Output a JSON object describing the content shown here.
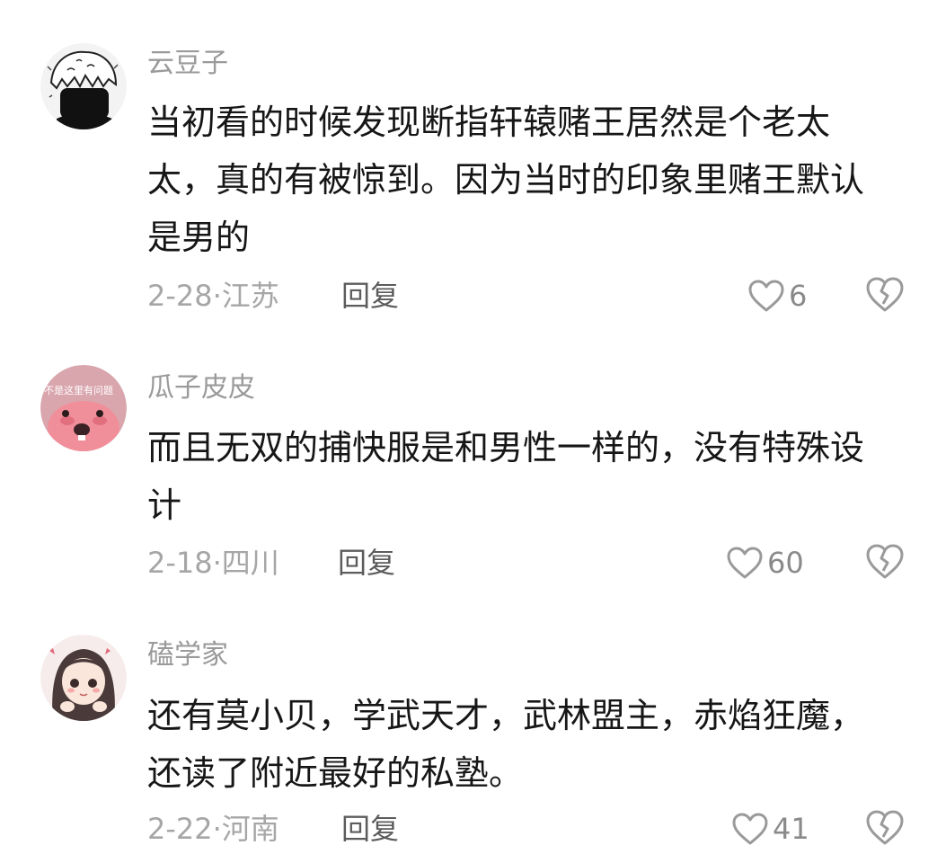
{
  "comments": [
    {
      "username": "云豆子",
      "lines": [
        "当初看的时候发现断指轩辕赌王居然是个老太",
        "太，真的有被惊到。因为当时的印象里赌王默认",
        "是男的"
      ],
      "date": "2-28",
      "location": "江苏",
      "reply_label": "回复",
      "likes": "6",
      "avatar_icon": "anime-boy-mask-avatar"
    },
    {
      "username": "瓜子皮皮",
      "lines": [
        "而且无双的捕快服是和男性一样的，没有特殊设",
        "计"
      ],
      "date": "2-18",
      "location": "四川",
      "reply_label": "回复",
      "likes": "60",
      "avatar_icon": "pink-beaver-avatar",
      "avatar_caption": "不是这里有问题"
    },
    {
      "username": "磕学家",
      "lines": [
        "还有莫小贝，学武天才，武林盟主，赤焰狂魔，",
        "还读了附近最好的私塾。"
      ],
      "date": "2-22",
      "location": "河南",
      "reply_label": "回复",
      "likes": "41",
      "avatar_icon": "anime-girl-avatar"
    }
  ],
  "separator": "·",
  "icons": {
    "like": "heart-outline-icon",
    "dislike": "broken-heart-icon"
  },
  "colors": {
    "text": "#161616",
    "username": "#9a9a9a",
    "meta": "#a6a6a6",
    "reply": "#5c5c5c"
  }
}
